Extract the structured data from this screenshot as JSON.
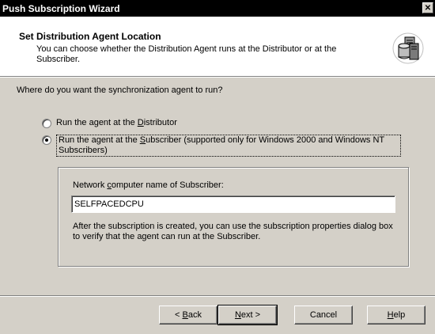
{
  "window": {
    "title": "Push Subscription Wizard",
    "close_glyph": "✕"
  },
  "header": {
    "title": "Set Distribution Agent Location",
    "description": "You can choose whether the Distribution Agent runs at the Distributor or at the Subscriber.",
    "icon": "database-servers-icon"
  },
  "main": {
    "question": "Where do you want the synchronization agent to run?",
    "options": [
      {
        "pre": "Run the agent at the ",
        "accel": "D",
        "post": "istributor",
        "checked": false
      },
      {
        "pre": "Run the agent at the ",
        "accel": "S",
        "post": "ubscriber (supported only for Windows 2000 and Windows NT Subscribers)",
        "checked": true
      }
    ],
    "group": {
      "label_pre": "Network ",
      "label_accel": "c",
      "label_post": "omputer name of Subscriber:",
      "value": "SELFPACEDCPU",
      "note": "After the subscription is created, you can use the subscription properties dialog box to verify that the agent can run at the Subscriber."
    }
  },
  "buttons": {
    "back_pre": "< ",
    "back_accel": "B",
    "back_post": "ack",
    "next_accel": "N",
    "next_post": "ext >",
    "cancel": "Cancel",
    "help_accel": "H",
    "help_post": "elp"
  }
}
